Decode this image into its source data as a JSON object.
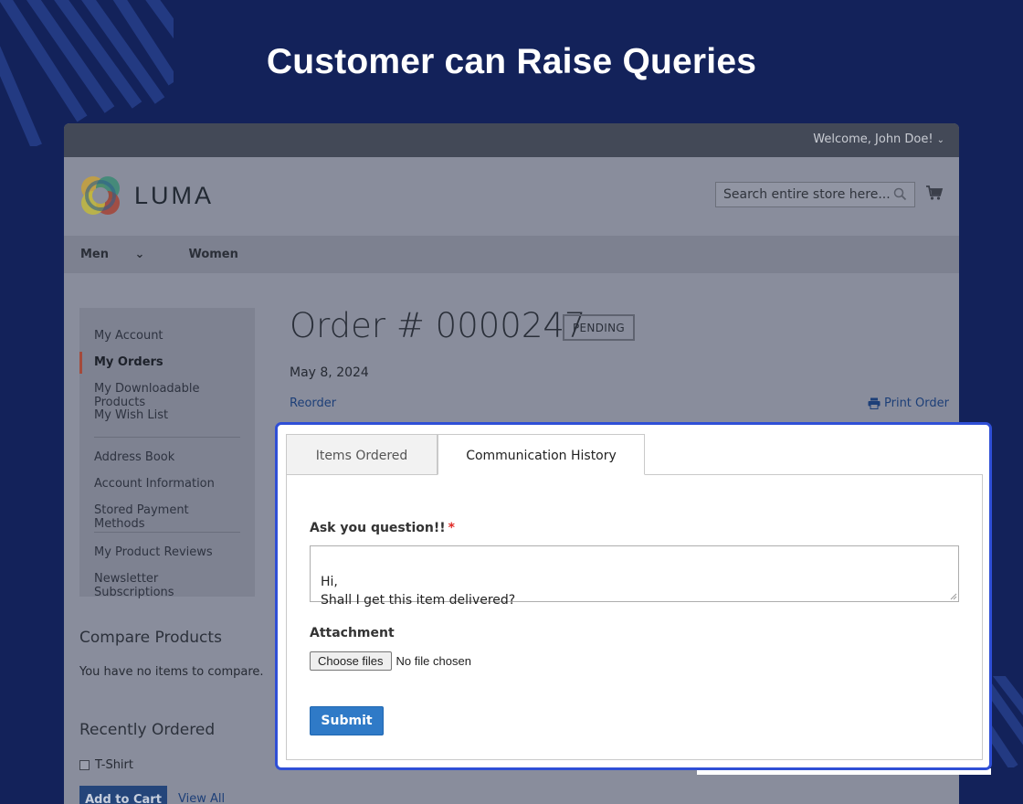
{
  "hero": {
    "title": "Customer can Raise Queries"
  },
  "topbar": {
    "welcome": "Welcome, John Doe!"
  },
  "header": {
    "logo_text": "LUMA",
    "search_placeholder": "Search entire store here..."
  },
  "nav": {
    "items": [
      "Men",
      "Women"
    ]
  },
  "sidebar": {
    "group1": [
      "My Account",
      "My Orders",
      "My Downloadable Products",
      "My Wish List"
    ],
    "group2": [
      "Address Book",
      "Account Information",
      "Stored Payment Methods"
    ],
    "group3": [
      "My Product Reviews",
      "Newsletter Subscriptions"
    ],
    "active": "My Orders"
  },
  "compare": {
    "title": "Compare Products",
    "text": "You have no items to compare."
  },
  "recent": {
    "title": "Recently Ordered",
    "item": "T-Shirt",
    "add_to_cart": "Add to Cart",
    "view_all": "View All"
  },
  "order": {
    "title": "Order # 0000247",
    "status": "PENDING",
    "date": "May 8, 2024",
    "reorder": "Reorder",
    "print": "Print Order"
  },
  "tabs": {
    "items_ordered": "Items Ordered",
    "history": "Communication History"
  },
  "form": {
    "question_label": "Ask you question!!",
    "required_mark": "*",
    "question_value": "Hi,\nShall I get this item delivered?",
    "attachment_label": "Attachment",
    "choose_files": "Choose files",
    "no_file": "No file chosen",
    "submit": "Submit"
  },
  "colors": {
    "background": "#13225a",
    "highlight_border": "#2f4fd6",
    "submit_button": "#2f7ac7",
    "required": "#e02b27"
  }
}
